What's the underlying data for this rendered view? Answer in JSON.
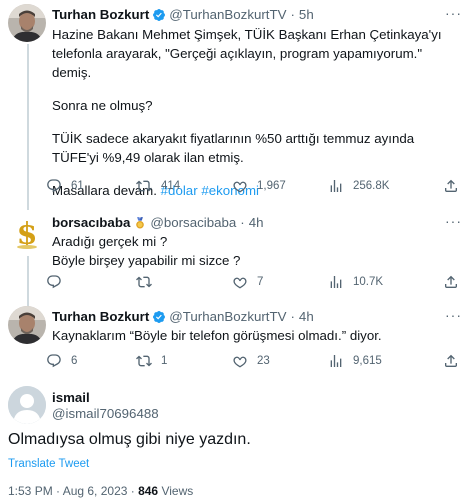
{
  "tweets": [
    {
      "name": "Turhan Bozkurt",
      "handle": "@TurhanBozkurtTV",
      "sep": "·",
      "time": "5h",
      "paragraphs": [
        "Hazine Bakanı Mehmet Şimşek, TÜİK Başkanı Erhan Çetinkaya'yı telefonla arayarak, \"Gerçeği açıklayın, program yapamıyorum.\" demiş.",
        "Sonra ne olmuş?",
        "TÜİK sadece akaryakıt fiyatlarının %50 arttığı temmuz ayında TÜFE'yi %9,49 olarak ilan etmiş.",
        "Masallara devam."
      ],
      "hashtags": [
        "#dolar",
        "#ekonomi"
      ],
      "replies": "61",
      "retweets": "414",
      "likes": "1,967",
      "views": "256.8K"
    },
    {
      "name": "borsacıbaba",
      "handle": "@borsacibaba",
      "sep": "·",
      "time": "4h",
      "paragraphs": [
        "Aradığı gerçek mi ?",
        "Böyle birşey yapabilir mi sizce ?"
      ],
      "replies": "",
      "retweets": "",
      "likes": "7",
      "views": "10.7K"
    },
    {
      "name": "Turhan Bozkurt",
      "handle": "@TurhanBozkurtTV",
      "sep": "·",
      "time": "4h",
      "paragraphs": [
        "Kaynaklarım “Böyle bir telefon görüşmesi olmadı.” diyor."
      ],
      "replies": "6",
      "retweets": "1",
      "likes": "23",
      "views": "9,615"
    }
  ],
  "main_tweet": {
    "name": "ismail",
    "handle": "@ismail70696488",
    "text": "Olmadıysa olmuş gibi niye yazdın.",
    "translate": "Translate Tweet",
    "time": "1:53 PM · Aug 6, 2023 · ",
    "views_count": "846",
    "views_label": " Views"
  },
  "colors": {
    "accent": "#1d9bf0",
    "muted": "#536471",
    "divider": "#eff3f4",
    "verified": "#1d9bf0"
  },
  "icons": [
    "reply-icon",
    "retweet-icon",
    "like-icon",
    "views-icon",
    "share-icon",
    "more-icon",
    "verified-badge-icon",
    "medal-icon"
  ]
}
